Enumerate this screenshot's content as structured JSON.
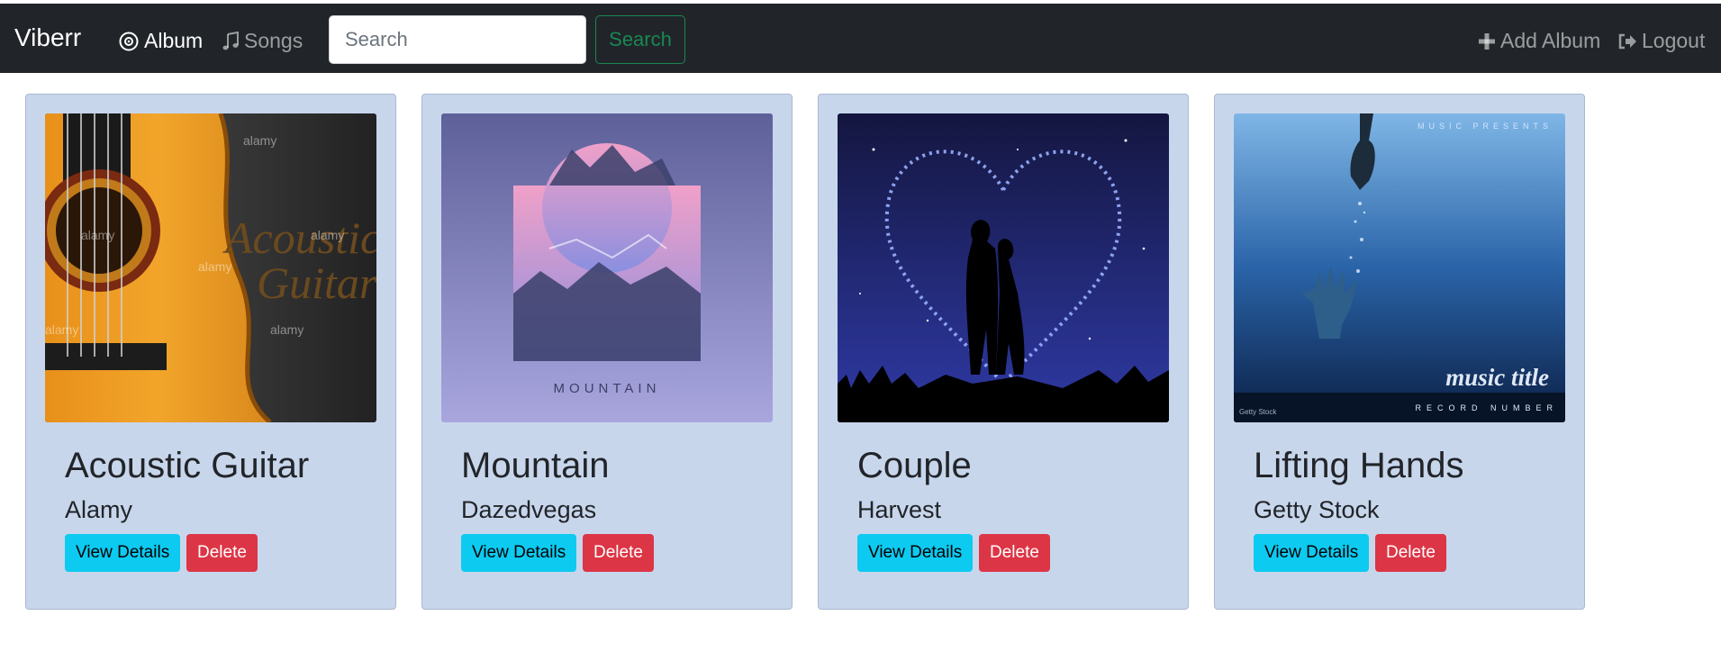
{
  "navbar": {
    "brand": "Viberr",
    "links": [
      {
        "label": "Album",
        "icon": "disc-icon",
        "active": true
      },
      {
        "label": "Songs",
        "icon": "music-note-icon",
        "active": false
      }
    ],
    "search": {
      "placeholder": "Search",
      "value": "",
      "button_label": "Search"
    },
    "right_links": [
      {
        "label": "Add Album",
        "icon": "plus-icon"
      },
      {
        "label": "Logout",
        "icon": "logout-icon"
      }
    ]
  },
  "albums": [
    {
      "title": "Acoustic Guitar",
      "artist": "Alamy",
      "view_label": "View Details",
      "delete_label": "Delete",
      "cover_text": "Acoustic Guitar",
      "watermark": "alamy"
    },
    {
      "title": "Mountain",
      "artist": "Dazedvegas",
      "view_label": "View Details",
      "delete_label": "Delete",
      "cover_text": "MOUNTAIN"
    },
    {
      "title": "Couple",
      "artist": "Harvest",
      "view_label": "View Details",
      "delete_label": "Delete"
    },
    {
      "title": "Lifting Hands",
      "artist": "Getty Stock",
      "view_label": "View Details",
      "delete_label": "Delete",
      "cover_top": "MUSIC PRESENTS",
      "cover_title": "music title",
      "cover_bottom": "RECORD NUMBER",
      "cover_credit": "Getty Stock"
    }
  ],
  "colors": {
    "navbar_bg": "#212529",
    "card_bg": "#c8d6ec",
    "view_button": "#0dcaf0",
    "delete_button": "#dc3545",
    "search_button": "#198754"
  }
}
